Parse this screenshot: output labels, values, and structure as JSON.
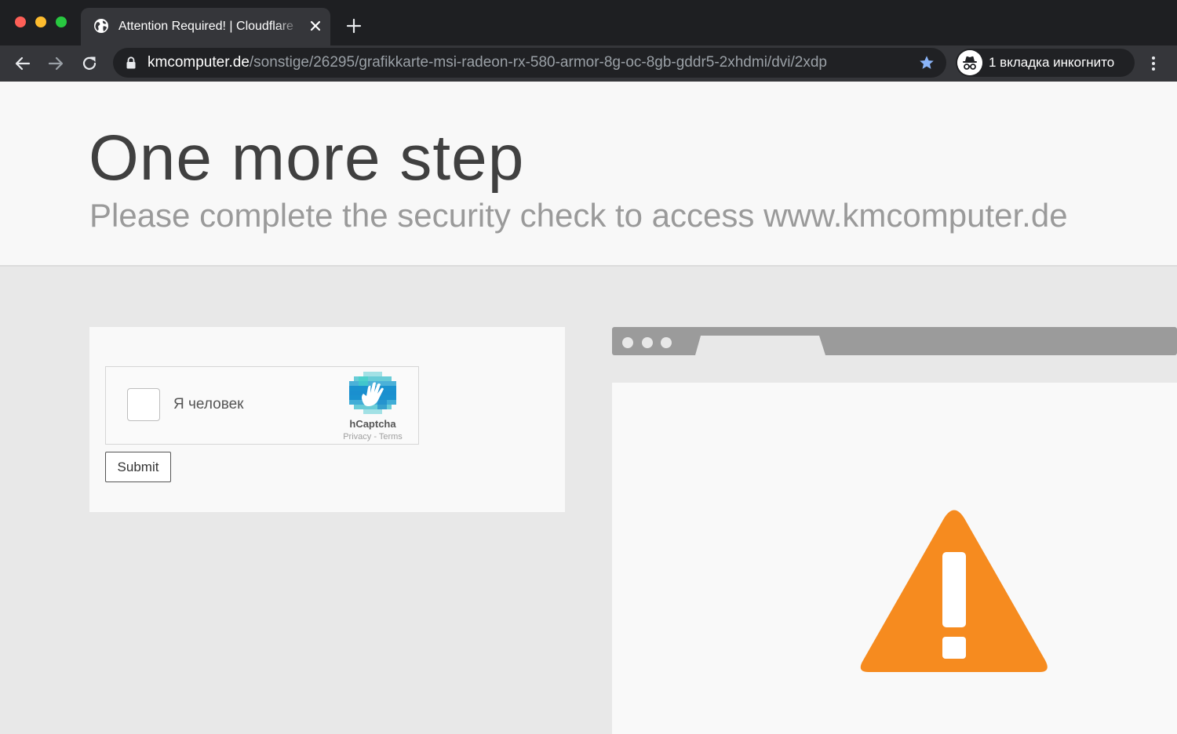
{
  "browser": {
    "tab_title": "Attention Required! | Cloudflare",
    "url_host": "kmcomputer.de",
    "url_path": "/sonstige/26295/grafikkarte-msi-radeon-rx-580-armor-8g-oc-8gb-gddr5-2xhdmi/dvi/2xdp",
    "incognito_label": "1 вкладка инкогнито",
    "icons": [
      "globe-icon",
      "close-icon",
      "plus-icon",
      "back-arrow-icon",
      "forward-arrow-icon",
      "reload-icon",
      "lock-icon",
      "star-icon",
      "incognito-icon",
      "kebab-menu-icon"
    ],
    "colors": {
      "chrome_dark": "#202124",
      "toolbar": "#35363a",
      "star": "#8ab4f8"
    }
  },
  "page": {
    "title": "One more step",
    "subtitle": "Please complete the security check to access www.kmcomputer.de"
  },
  "captcha": {
    "checkbox_label": "Я человек",
    "brand": "hCaptcha",
    "links": "Privacy - Terms",
    "submit_label": "Submit"
  },
  "illustration": {
    "icon": "warning-triangle-icon",
    "warning_color": "#f68b1f"
  }
}
